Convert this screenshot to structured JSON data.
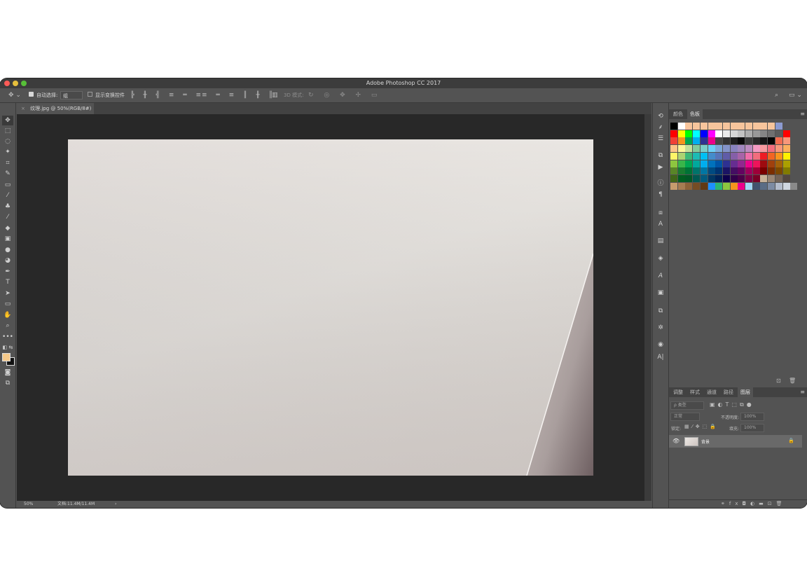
{
  "app": {
    "title": "Adobe Photoshop CC 2017",
    "traffic_colors": [
      "#fc5b57",
      "#e5bf3c",
      "#57c038"
    ]
  },
  "options_bar": {
    "auto_select_label": "自动选择:",
    "auto_select_value": "组",
    "show_transform_label": "显示变换控件",
    "mode3d_label": "3D 模式:"
  },
  "document": {
    "tab_title": "纹理.jpg @ 50%(RGB/8#) *"
  },
  "status": {
    "zoom": "50%",
    "doc_size": "文档:11.4M/11.4M",
    "arrow": "›"
  },
  "colors": {
    "foreground": "#f5c98a",
    "background": "#111111"
  },
  "swatches_panel": {
    "tabs": [
      "颜色",
      "色板"
    ],
    "active_tab": "色板"
  },
  "layers_panel": {
    "tabs": [
      "调整",
      "样式",
      "通道",
      "路径",
      "图层"
    ],
    "active_tab": "图层",
    "filter_placeholder": "ρ 类型",
    "blend_mode": "正常",
    "opacity_label": "不透明度:",
    "opacity_value": "100%",
    "lock_label": "锁定:",
    "fill_label": "填充:",
    "fill_value": "100%",
    "layers": [
      {
        "name": "背景",
        "visible": true,
        "locked": true
      }
    ]
  }
}
